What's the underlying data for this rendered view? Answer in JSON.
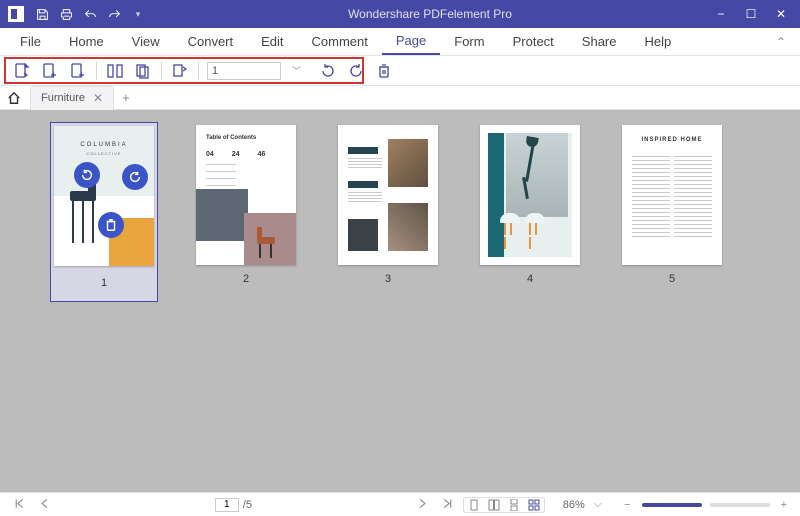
{
  "app": {
    "title": "Wondershare PDFelement Pro"
  },
  "qat": {
    "save_icon": "save-icon",
    "print_icon": "print-icon",
    "undo_icon": "undo-icon",
    "redo_icon": "redo-icon",
    "customize_icon": "chevron-down-icon"
  },
  "win": {
    "minimize": "−",
    "maximize": "☐",
    "close": "✕"
  },
  "menu": {
    "items": [
      {
        "label": "File"
      },
      {
        "label": "Home"
      },
      {
        "label": "View"
      },
      {
        "label": "Convert"
      },
      {
        "label": "Edit"
      },
      {
        "label": "Comment"
      },
      {
        "label": "Page"
      },
      {
        "label": "Form"
      },
      {
        "label": "Protect"
      },
      {
        "label": "Share"
      },
      {
        "label": "Help"
      }
    ],
    "active_index": 6
  },
  "toolbar": {
    "page_input": "1",
    "tools": {
      "insert": "insert-page-icon",
      "insert_blank": "insert-blank-page-icon",
      "insert_from": "insert-from-file-icon",
      "split": "split-page-icon",
      "extract": "extract-page-icon",
      "replace": "replace-page-icon",
      "rotate_ccw": "rotate-ccw-icon",
      "rotate_cw": "rotate-cw-icon",
      "delete": "delete-page-icon"
    }
  },
  "doc_tabs": {
    "items": [
      {
        "label": "Furniture"
      }
    ]
  },
  "thumbs": {
    "selected": 1,
    "pages": [
      {
        "num": "1",
        "title": "COLUMBIA",
        "subtitle": "COLLECTIVE"
      },
      {
        "num": "2",
        "title": "Table of Contents",
        "sections": [
          "04",
          "24",
          "46"
        ]
      },
      {
        "num": "3"
      },
      {
        "num": "4"
      },
      {
        "num": "5",
        "title": "INSPIRED HOME"
      }
    ],
    "overlay_icons": {
      "rotate_ccw": "rotate-ccw-icon",
      "rotate_cw": "rotate-cw-icon",
      "delete": "trash-icon"
    }
  },
  "status": {
    "current_page": "1",
    "total_pages": "/5",
    "zoom": "86%"
  }
}
